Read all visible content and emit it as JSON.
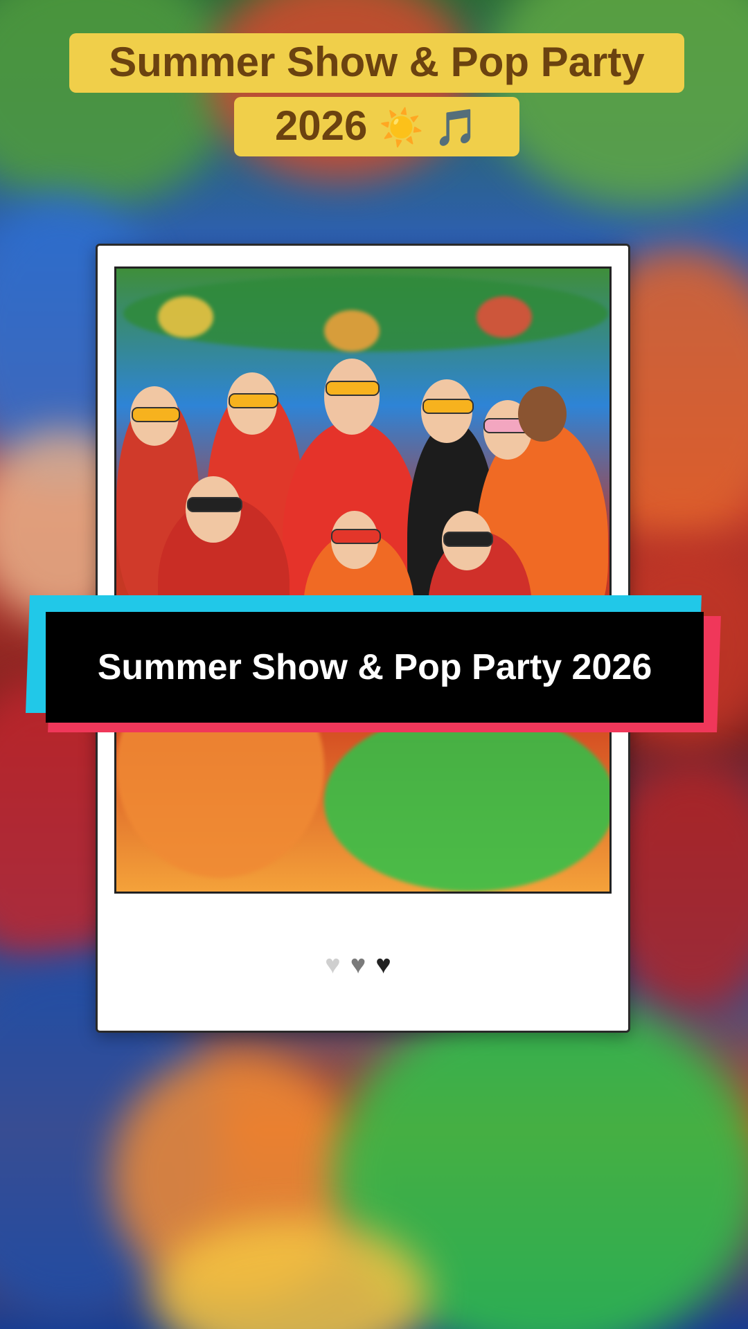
{
  "title": {
    "line1": "Summer Show & Pop Party",
    "line2_text": "2026",
    "line2_emoji": "☀️ 🎵"
  },
  "caption": {
    "text": "Summer Show & Pop Party 2026"
  },
  "photo": {
    "description_icon": "group-party-photo"
  },
  "hearts": [
    "♥",
    "♥",
    "♥"
  ],
  "colors": {
    "title_bg": "#f0cf4a",
    "title_text": "#6b4210",
    "caption_cyan": "#21c8e8",
    "caption_red": "#f0375a",
    "caption_bg": "#000000"
  }
}
